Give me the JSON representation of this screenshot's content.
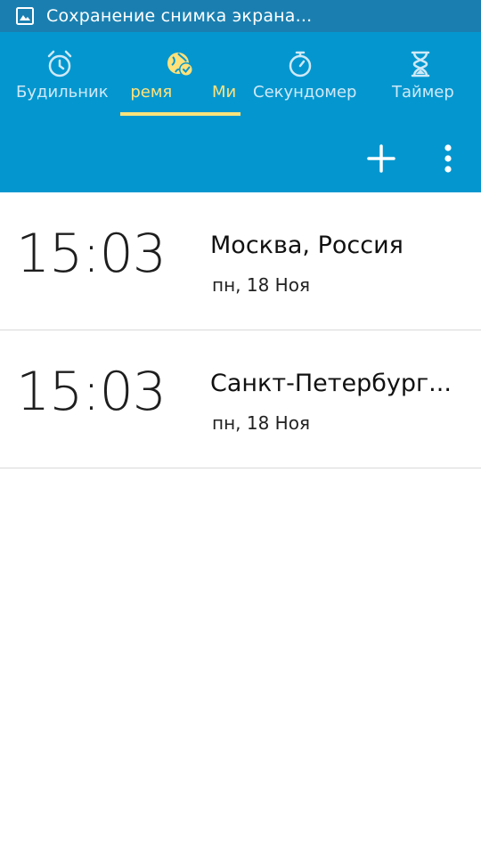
{
  "status_bar": {
    "text": "Сохранение снимка экрана...",
    "icon": "screenshot-icon"
  },
  "tabs": [
    {
      "label": "Будильник",
      "icon": "alarm-clock-icon",
      "active": false
    },
    {
      "label": "Время",
      "icon": "globe-clock-icon",
      "active": true
    },
    {
      "label": "Ми",
      "icon": "",
      "active": false
    },
    {
      "label": "Секундомер",
      "icon": "stopwatch-icon",
      "active": false
    },
    {
      "label": "Таймер",
      "icon": "hourglass-icon",
      "active": false
    }
  ],
  "toolbar": {
    "add_icon": "plus-icon",
    "menu_icon": "more-vert-icon"
  },
  "clocks": [
    {
      "time": "15:03",
      "city": "Москва, Россия",
      "date": "пн, 18 Ноя"
    },
    {
      "time": "15:03",
      "city": "Санкт-Петербург...",
      "date": "пн, 18 Ноя"
    }
  ],
  "colors": {
    "status_bar": "#1a7fb0",
    "header": "#0497cf",
    "active_tab": "#ffe27a",
    "inactive_tab": "#cfe9f7"
  }
}
